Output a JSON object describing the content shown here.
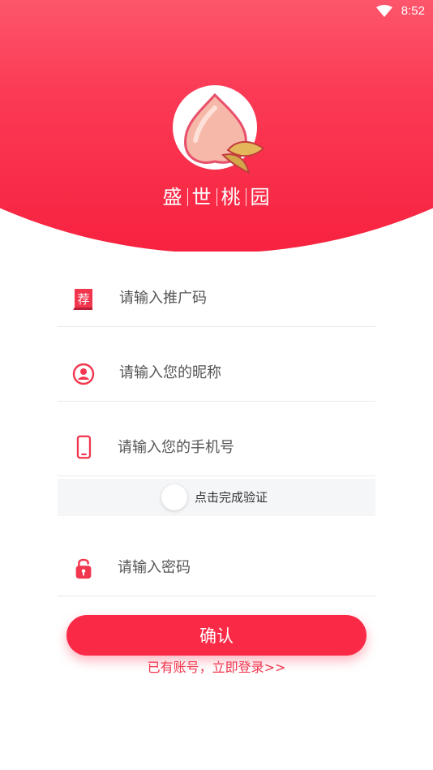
{
  "status_bar": {
    "time": "8:52",
    "wifi_icon": "wifi-icon"
  },
  "header": {
    "brand_chars": [
      "盛",
      "世",
      "桃",
      "园"
    ],
    "logo_icon": "peach-logo-icon"
  },
  "form": {
    "referral": {
      "placeholder": "请输入推广码",
      "icon": "recommend-icon"
    },
    "nickname": {
      "placeholder": "请输入您的昵称",
      "icon": "user-icon"
    },
    "phone": {
      "placeholder": "请输入您的手机号",
      "icon": "phone-icon"
    },
    "verify": {
      "label": "点击完成验证"
    },
    "password": {
      "placeholder": "请输入密码",
      "icon": "lock-icon"
    }
  },
  "actions": {
    "confirm_label": "确认",
    "login_link": "已有账号，立即登录>>"
  },
  "colors": {
    "accent": "#fa2a47",
    "header_top": "#ff8a99",
    "header_bottom": "#f7223f"
  }
}
